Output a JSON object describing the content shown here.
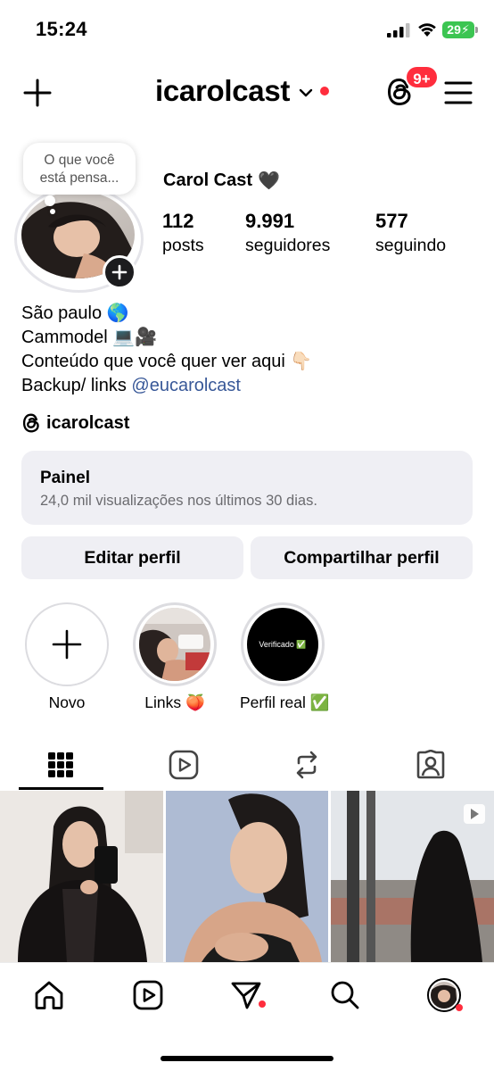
{
  "status_bar": {
    "time": "15:24",
    "battery": "29"
  },
  "header": {
    "username": "icarolcast",
    "notification_badge": "9+",
    "icons": {
      "create": "plus-icon",
      "account_switch": "chevron-down-icon",
      "threads": "threads-icon",
      "menu": "hamburger-menu-icon"
    }
  },
  "profile": {
    "note_text": "O que você está pensa...",
    "display_name": "Carol Cast",
    "display_name_emoji": "🖤",
    "stats": [
      {
        "value": "112",
        "label": "posts"
      },
      {
        "value": "9.991",
        "label": "seguidores"
      },
      {
        "value": "577",
        "label": "seguindo"
      }
    ],
    "bio": {
      "line1": "São paulo 🌎",
      "line2": "Cammodel 💻🎥",
      "line3": "Conteúdo que você quer ver aqui 👇🏻",
      "line4_prefix": "Backup/ links ",
      "line4_link": "@eucarolcast"
    },
    "threads_handle": "icarolcast"
  },
  "dashboard": {
    "title": "Painel",
    "subtitle": "24,0 mil visualizações nos últimos 30 dias."
  },
  "buttons": {
    "edit": "Editar perfil",
    "share": "Compartilhar perfil"
  },
  "highlights": [
    {
      "label": "Novo"
    },
    {
      "label": "Links 🍑"
    },
    {
      "label": "Perfil real ✅",
      "cover_text": "Verificado ✅"
    }
  ],
  "tabs": [
    {
      "name": "grid",
      "icon": "grid-icon",
      "active": true
    },
    {
      "name": "reels",
      "icon": "reels-icon"
    },
    {
      "name": "reposts",
      "icon": "repost-icon"
    },
    {
      "name": "tagged",
      "icon": "tagged-person-icon"
    }
  ],
  "bottom_nav": [
    {
      "name": "home",
      "icon": "home-icon"
    },
    {
      "name": "reels",
      "icon": "reels-icon"
    },
    {
      "name": "messages",
      "icon": "send-icon"
    },
    {
      "name": "search",
      "icon": "search-icon"
    },
    {
      "name": "profile",
      "icon": "profile-avatar"
    }
  ],
  "colors": {
    "accent_red": "#ff2d3d",
    "link_blue": "#385898",
    "surface_gray": "#efeff4"
  }
}
